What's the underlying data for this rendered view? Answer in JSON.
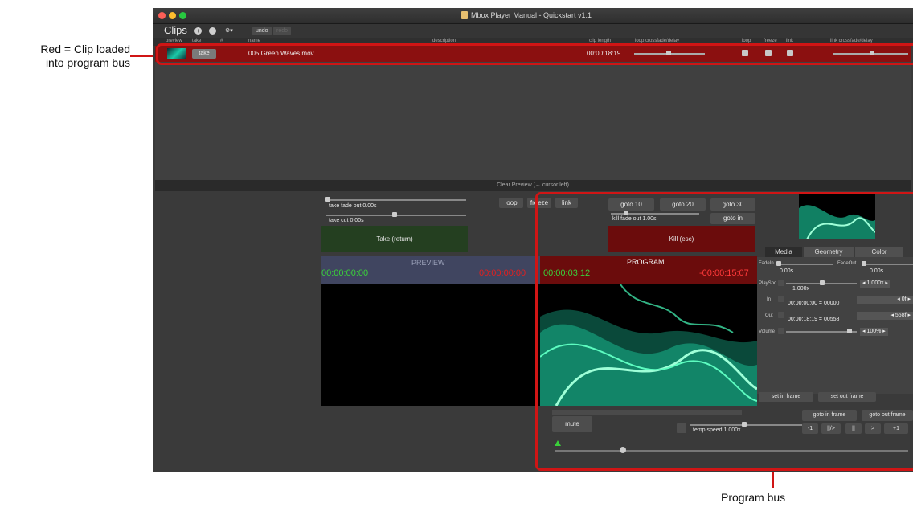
{
  "annotations": {
    "left_note_line1": "Red = Clip loaded",
    "left_note_line2": "into program bus",
    "bottom_note": "Program bus"
  },
  "window": {
    "title": "Mbox Player Manual - Quickstart v1.1",
    "colors": {
      "red": "#fc5f57",
      "yellow": "#fdbc2e",
      "green": "#28c840"
    }
  },
  "toolbar": {
    "title": "Clips",
    "add_icon": "+",
    "remove_icon": "−",
    "gear_icon": "⚙▾",
    "undo": "undo",
    "redo": "redo"
  },
  "clip_table": {
    "headers": [
      "preview",
      "take",
      "#",
      "name",
      "description",
      "clip length",
      "loop crossfade/delay",
      "loop",
      "freeze",
      "link",
      "link crossfade/delay"
    ],
    "rows": [
      {
        "take_label": "take",
        "name": "005.Green Waves.mov",
        "clip_length": "00:00:18:19"
      }
    ]
  },
  "clear_preview": "Clear Preview (← cursor left)",
  "preview_controls": {
    "take_fade_out": "take fade out 0.00s",
    "take_cut": "take cut 0.00s",
    "take_button": "Take (return)",
    "loop": "loop",
    "freeze": "freeze",
    "link": "link"
  },
  "program_controls": {
    "goto10": "goto 10",
    "goto20": "goto 20",
    "goto30": "goto 30",
    "kill_fade_out": "kill fade out 1.00s",
    "goto_in": "goto in",
    "kill_button": "Kill (esc)"
  },
  "preview": {
    "label": "PREVIEW",
    "timecode": "00:00:00:00",
    "remaining": "00:00:00:00"
  },
  "program": {
    "label": "PROGRAM",
    "timecode": "00:00:03:12",
    "remaining": "-00:00:15:07"
  },
  "inspector": {
    "tabs": [
      "Media",
      "Geometry",
      "Color"
    ],
    "fadein_label": "FadeIn",
    "fadein_value": "0.00s",
    "fadeout_label": "FadeOut",
    "fadeout_value": "0.00s",
    "playspd_label": "PlaySpd",
    "playspd_value": "1.000x",
    "playspd_spin": "◂ 1.000x ▸",
    "in_label": "In",
    "in_value": "00:00:00:00 = 00000",
    "in_spin": "◂ 0f ▸",
    "out_label": "Out",
    "out_value": "00:00:18:19 = 00558",
    "out_spin": "◂ 558f ▸",
    "volume_label": "Volume",
    "volume_spin": "◂ 100% ▸",
    "set_in": "set in frame",
    "set_out": "set out frame"
  },
  "transport": {
    "mute": "mute",
    "temp_speed": "temp speed 1.000x",
    "goto_in_frame": "goto in frame",
    "goto_out_frame": "goto out frame",
    "minus1": "-1",
    "play_pause": "||/>",
    "pause": "||",
    "play": ">",
    "plus1": "+1"
  }
}
